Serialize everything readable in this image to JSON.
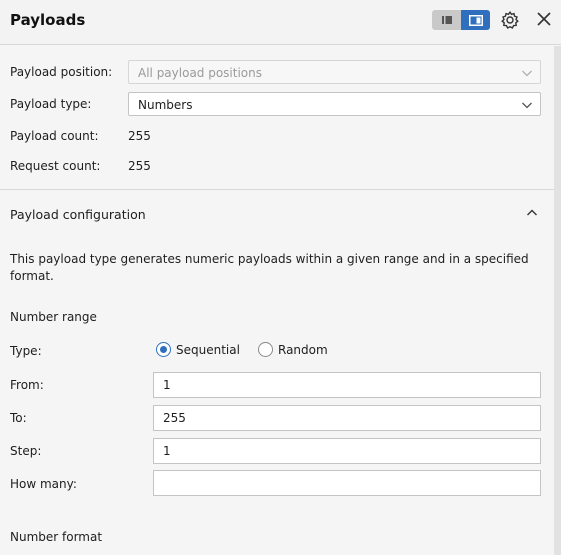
{
  "header": {
    "title": "Payloads",
    "layout_toggle": {
      "left_icon": "single-column-icon",
      "right_icon": "split-panel-icon",
      "active": "right"
    },
    "settings_icon": "gear-icon",
    "close_icon": "close-icon"
  },
  "payload_sets": {
    "position_label": "Payload position:",
    "position_value": "All payload positions",
    "type_label": "Payload type:",
    "type_value": "Numbers",
    "count_label": "Payload count:",
    "count_value": "255",
    "request_label": "Request count:",
    "request_value": "255"
  },
  "config": {
    "title": "Payload configuration",
    "description": "This payload type generates numeric payloads within a given range and in a specified format.",
    "number_range": "Number range",
    "type_label": "Type:",
    "type_options": [
      "Sequential",
      "Random"
    ],
    "type_selected": "Sequential",
    "from_label": "From:",
    "from_value": "1",
    "to_label": "To:",
    "to_value": "255",
    "step_label": "Step:",
    "step_value": "1",
    "how_many_label": "How many:",
    "how_many_value": "",
    "number_format": "Number format"
  },
  "colors": {
    "accent": "#2f6fbd",
    "background": "#f5f5f5"
  }
}
